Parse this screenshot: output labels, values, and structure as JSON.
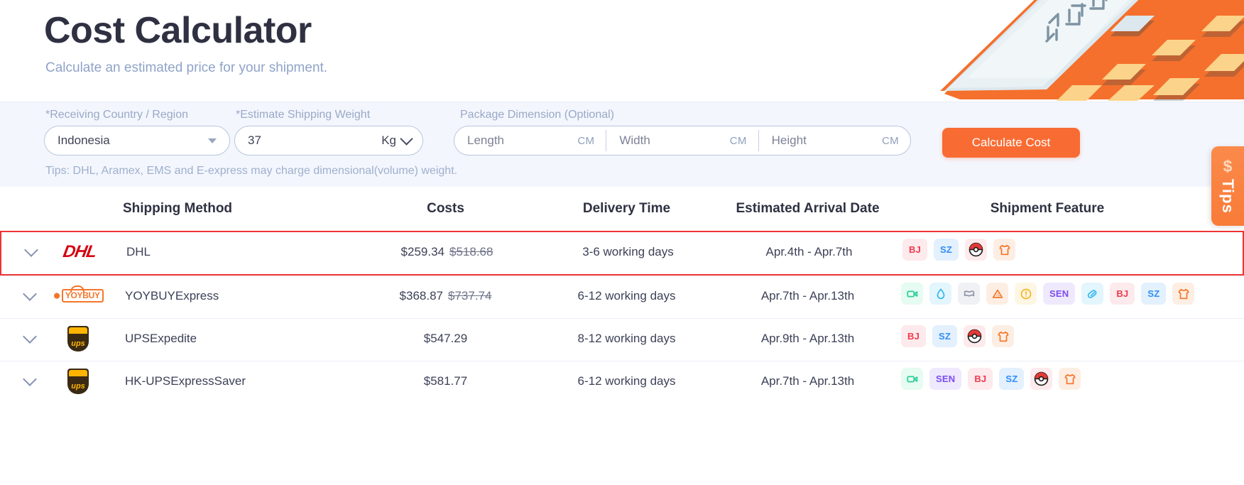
{
  "hero": {
    "title": "Cost Calculator",
    "subtitle": "Calculate an estimated price for your shipment.",
    "illustration": "calculator-illustration"
  },
  "form": {
    "country_label": "*Receiving Country / Region",
    "country_value": "Indonesia",
    "weight_label": "*Estimate Shipping Weight",
    "weight_value": "37",
    "weight_unit": "Kg",
    "dimension_label": "Package Dimension (Optional)",
    "length_placeholder": "Length",
    "width_placeholder": "Width",
    "height_placeholder": "Height",
    "unit_cm": "CM",
    "tips_note": "Tips: DHL, Aramex, EMS and E-express may charge dimensional(volume) weight.",
    "calculate_label": "Calculate Cost",
    "accent_color": "#f86c34"
  },
  "side_tab": {
    "dollar": "$",
    "label": "Tips"
  },
  "table": {
    "headers": {
      "method": "Shipping Method",
      "costs": "Costs",
      "time": "Delivery Time",
      "date": "Estimated Arrival Date",
      "feature": "Shipment Feature"
    },
    "rows": [
      {
        "logo": "dhl-logo",
        "logo_text": "DHL",
        "name": "DHL",
        "cost": "$259.34",
        "cost_original": "$518.68",
        "time": "3-6 working days",
        "date": "Apr.4th - Apr.7th",
        "highlighted": true,
        "features": [
          {
            "icon": "bj-badge-icon",
            "text": "BJ",
            "fg": "#ef3b4e",
            "bg": "#fdeaec"
          },
          {
            "icon": "sz-badge-icon",
            "text": "SZ",
            "fg": "#2f8df6",
            "bg": "#e3f0fe"
          },
          {
            "icon": "pokeball-icon",
            "text": "",
            "fg": "#e53935",
            "bg": "#fdeaec"
          },
          {
            "icon": "tshirt-icon",
            "text": "",
            "fg": "#f5762a",
            "bg": "#fdeee3"
          }
        ]
      },
      {
        "logo": "yoybuy-logo",
        "logo_text": "YOYBUY",
        "name": "YOYBUYExpress",
        "cost": "$368.87",
        "cost_original": "$737.74",
        "time": "6-12 working days",
        "date": "Apr.7th - Apr.13th",
        "highlighted": false,
        "features": [
          {
            "icon": "video-camera-icon",
            "text": "",
            "fg": "#2ecc9b",
            "bg": "#e6fbf2"
          },
          {
            "icon": "water-drop-icon",
            "text": "",
            "fg": "#36b7f0",
            "bg": "#e3f5fd"
          },
          {
            "icon": "flag-icon",
            "text": "",
            "fg": "#8d93a6",
            "bg": "#f0f1f5"
          },
          {
            "icon": "powder-icon",
            "text": "",
            "fg": "#f5762a",
            "bg": "#fdeee3"
          },
          {
            "icon": "warning-circle-icon",
            "text": "",
            "fg": "#f5b324",
            "bg": "#fdf6e3"
          },
          {
            "icon": "sen-badge-icon",
            "text": "SEN",
            "fg": "#7b4df0",
            "bg": "#efe9fe"
          },
          {
            "icon": "capsule-icon",
            "text": "",
            "fg": "#36b7f0",
            "bg": "#e3f5fd"
          },
          {
            "icon": "bj-badge-icon",
            "text": "BJ",
            "fg": "#ef3b4e",
            "bg": "#fdeaec"
          },
          {
            "icon": "sz-badge-icon",
            "text": "SZ",
            "fg": "#2f8df6",
            "bg": "#e3f0fe"
          },
          {
            "icon": "tshirt-icon",
            "text": "",
            "fg": "#f5762a",
            "bg": "#fdeee3"
          }
        ]
      },
      {
        "logo": "ups-logo",
        "logo_text": "ups",
        "name": "UPSExpedite",
        "cost": "$547.29",
        "cost_original": "",
        "time": "8-12 working days",
        "date": "Apr.9th - Apr.13th",
        "highlighted": false,
        "features": [
          {
            "icon": "bj-badge-icon",
            "text": "BJ",
            "fg": "#ef3b4e",
            "bg": "#fdeaec"
          },
          {
            "icon": "sz-badge-icon",
            "text": "SZ",
            "fg": "#2f8df6",
            "bg": "#e3f0fe"
          },
          {
            "icon": "pokeball-icon",
            "text": "",
            "fg": "#e53935",
            "bg": "#fdeaec"
          },
          {
            "icon": "tshirt-icon",
            "text": "",
            "fg": "#f5762a",
            "bg": "#fdeee3"
          }
        ]
      },
      {
        "logo": "ups-logo",
        "logo_text": "ups",
        "name": "HK-UPSExpressSaver",
        "cost": "$581.77",
        "cost_original": "",
        "time": "6-12 working days",
        "date": "Apr.7th - Apr.13th",
        "highlighted": false,
        "features": [
          {
            "icon": "video-camera-icon",
            "text": "",
            "fg": "#2ecc9b",
            "bg": "#e6fbf2"
          },
          {
            "icon": "sen-badge-icon",
            "text": "SEN",
            "fg": "#7b4df0",
            "bg": "#efe9fe"
          },
          {
            "icon": "bj-badge-icon",
            "text": "BJ",
            "fg": "#ef3b4e",
            "bg": "#fdeaec"
          },
          {
            "icon": "sz-badge-icon",
            "text": "SZ",
            "fg": "#2f8df6",
            "bg": "#e3f0fe"
          },
          {
            "icon": "pokeball-icon",
            "text": "",
            "fg": "#e53935",
            "bg": "#fdeaec"
          },
          {
            "icon": "tshirt-icon",
            "text": "",
            "fg": "#f5762a",
            "bg": "#fdeee3"
          }
        ]
      }
    ]
  }
}
